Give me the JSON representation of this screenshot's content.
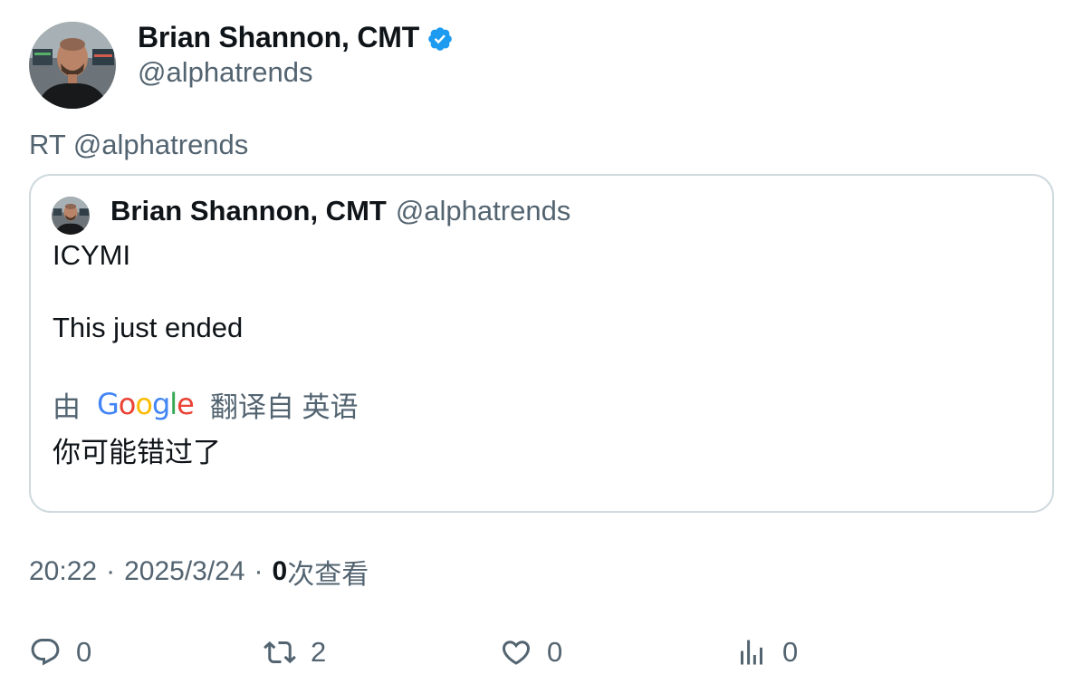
{
  "author": {
    "display_name": "Brian Shannon, CMT",
    "handle": "@alphatrends",
    "verified": true
  },
  "retweet_label": "RT @alphatrends",
  "quoted": {
    "display_name": "Brian Shannon, CMT",
    "handle": "@alphatrends",
    "lines": [
      "ICYMI",
      "This just ended"
    ],
    "translation": {
      "prefix": "由",
      "provider": "Google",
      "suffix": "翻译自 英语",
      "text": "你可能错过了"
    }
  },
  "meta": {
    "time": "20:22",
    "date": "2025/3/24",
    "views_count": "0",
    "views_label": "次查看"
  },
  "actions": {
    "reply_count": "0",
    "retweet_count": "2",
    "like_count": "0",
    "analytics_count": "0"
  },
  "colors": {
    "text": "#0f1419",
    "secondary": "#536471",
    "border": "#cfd9de",
    "verified": "#1d9bf0"
  }
}
